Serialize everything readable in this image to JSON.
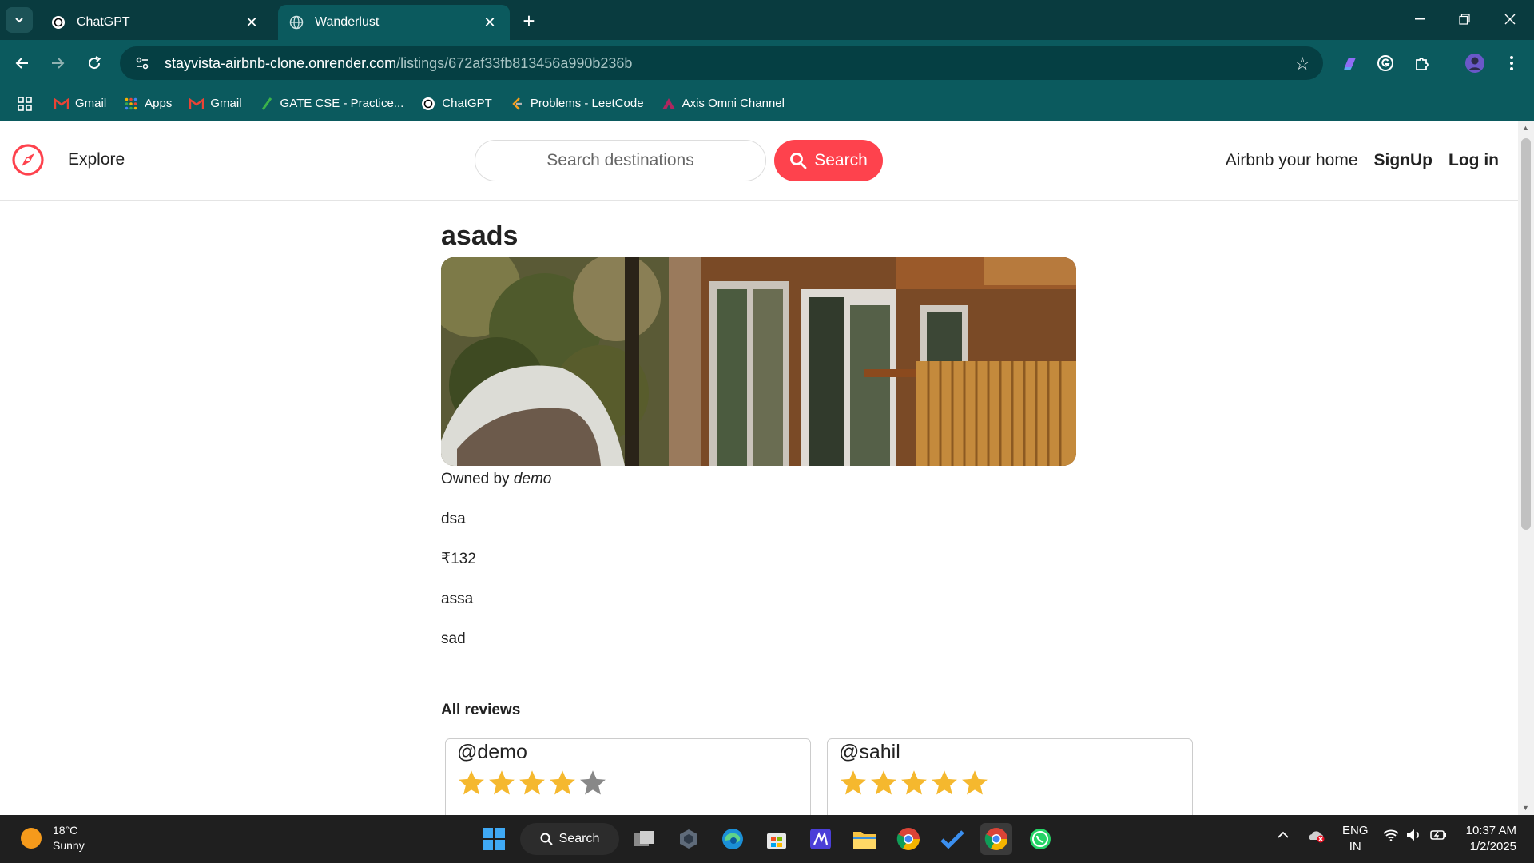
{
  "browser": {
    "tabs": [
      {
        "label": "ChatGPT",
        "icon": "chatgpt-icon",
        "active": false
      },
      {
        "label": "Wanderlust",
        "icon": "globe-icon",
        "active": true
      }
    ],
    "url_host": "stayvista-airbnb-clone.onrender.com",
    "url_path": "/listings/672af33fb813456a990b236b",
    "bookmarks": [
      {
        "label": "Gmail",
        "icon": "gmail-icon"
      },
      {
        "label": "Apps",
        "icon": "apps-grid-icon"
      },
      {
        "label": "Gmail",
        "icon": "gmail-icon"
      },
      {
        "label": "GATE CSE - Practice...",
        "icon": "gate-icon"
      },
      {
        "label": "ChatGPT",
        "icon": "chatgpt-icon"
      },
      {
        "label": "Problems - LeetCode",
        "icon": "leetcode-icon"
      },
      {
        "label": "Axis Omni Channel",
        "icon": "axis-icon"
      }
    ]
  },
  "navbar": {
    "explore": "Explore",
    "search_placeholder": "Search destinations",
    "search_button": "Search",
    "links": {
      "host": "Airbnb your home",
      "signup": "SignUp",
      "login": "Log in"
    },
    "accent": "#fe424d"
  },
  "listing": {
    "title": "asads",
    "owner_prefix": "Owned by",
    "owner": "demo",
    "description": "dsa",
    "price": "₹132",
    "location": "assa",
    "country": "sad"
  },
  "reviews": {
    "heading": "All reviews",
    "items": [
      {
        "user": "@demo",
        "rating": 4
      },
      {
        "user": "@sahil",
        "rating": 5
      }
    ]
  },
  "taskbar": {
    "temperature": "18°C",
    "condition": "Sunny",
    "search_label": "Search",
    "language": "ENG",
    "region": "IN",
    "time": "10:37 AM",
    "date": "1/2/2025"
  }
}
